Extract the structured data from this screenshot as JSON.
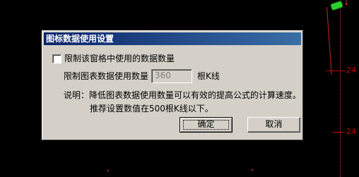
{
  "background_chart": {
    "price_labels": [
      "24",
      "24"
    ]
  },
  "dialog": {
    "title": "图标数据使用设置",
    "checkbox_label": "限制该窗格中使用的数据数量",
    "limit_label": "限制图表数据使用数量",
    "limit_value": "360",
    "limit_unit": "根K线",
    "note_line1": "说明：降低图表数据使用数量可以有效的提高公式的计算速度。",
    "note_line2": "推荐设置数值在500根K线以下。",
    "ok_label": "确定",
    "cancel_label": "取消"
  }
}
